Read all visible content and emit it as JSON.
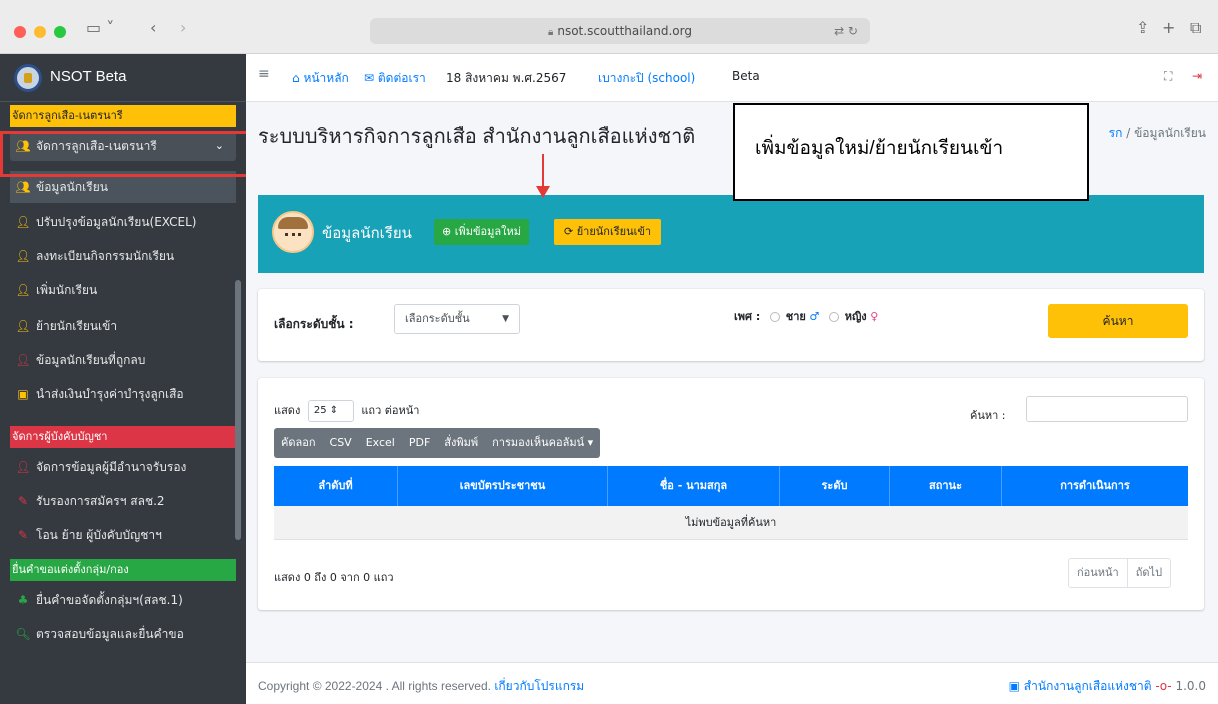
{
  "browser": {
    "url": "nsot.scoutthailand.org"
  },
  "sidebar": {
    "brand": "NSOT Beta",
    "section1": "จัดการลูกเสือ-เนตรนารี",
    "group_label": "จัดการลูกเสือ-เนตรนารี",
    "items": [
      {
        "label": "ข้อมูลนักเรียน",
        "icon": "users-icon"
      },
      {
        "label": "ปรับปรุงข้อมูลนักเรียน(EXCEL)",
        "icon": "user-edit-icon"
      },
      {
        "label": "ลงทะเบียนกิจกรรมนักเรียน",
        "icon": "user-check-icon"
      },
      {
        "label": "เพิ่มนักเรียน",
        "icon": "user-plus-icon"
      },
      {
        "label": "ย้ายนักเรียนเข้า",
        "icon": "user-plus-icon"
      },
      {
        "label": "ข้อมูลนักเรียนที่ถูกลบ",
        "icon": "user-minus-icon"
      },
      {
        "label": "นำส่งเงินบำรุงค่าบำรุงลูกเสือ",
        "icon": "money-icon"
      }
    ],
    "section2": "จัดการผู้บังคับบัญชา",
    "items2": [
      {
        "label": "จัดการข้อมูลผู้มีอำนาจรับรอง",
        "icon": "user-edit-icon"
      },
      {
        "label": "รับรองการสมัครฯ สลช.2",
        "icon": "edit-icon"
      },
      {
        "label": "โอน ย้าย ผู้บังคับบัญชาฯ",
        "icon": "edit-icon"
      }
    ],
    "section3": "ยื่นคำขอแต่งตั้งกลุ่ม/กอง",
    "items3": [
      {
        "label": "ยื่นคำขอจัดตั้งกลุ่มฯ(สลช.1)",
        "icon": "sitemap-icon"
      },
      {
        "label": "ตรวจสอบข้อมูลและยื่นคำขอ",
        "icon": "search-icon"
      }
    ]
  },
  "topbar": {
    "home": "หน้าหลัก",
    "contact": "ติดต่อเรา",
    "date": "18 สิงหาคม พ.ศ.2567",
    "school": "เบางกะปิ (school)",
    "beta": "Beta"
  },
  "page": {
    "title": "ระบบบริหารกิจการลูกเสือ สำนักงานลูกเสือแห่งชาติ",
    "crumb_link": "รก",
    "crumb_sep": " / ",
    "crumb_current": "ข้อมูลนักเรียน"
  },
  "banner": {
    "title": "ข้อมูลนักเรียน",
    "add_label": "เพิ่มข้อมูลใหม่",
    "move_label": "ย้ายนักเรียนเข้า"
  },
  "filter": {
    "level_label": "เลือกระดับชั้น :",
    "level_value": "เลือกระดับชั้น",
    "gender_label": "เพศ :",
    "male": "ชาย",
    "female": "หญิง",
    "search_button": "ค้นหา"
  },
  "table": {
    "show": "แสดง",
    "page_len": "25",
    "per_page": "แถว ต่อหน้า",
    "search_label": "ค้นหา :",
    "tools": [
      "คัดลอก",
      "CSV",
      "Excel",
      "PDF",
      "สั่งพิมพ์",
      "การมองเห็นคอลัมน์ ▾"
    ],
    "columns": [
      "ลำดับที่",
      "เลขบัตรประชาชน",
      "ชื่อ - นามสกุล",
      "ระดับ",
      "สถานะ",
      "การดำเนินการ"
    ],
    "empty": "ไม่พบข้อมูลที่ค้นหา",
    "info": "แสดง 0 ถึง 0 จาก 0 แถว",
    "prev": "ก่อนหน้า",
    "next": "ถัดไป"
  },
  "footer": {
    "copyright": "Copyright © 2022-2024 . All rights reserved.",
    "about": "เกี่ยวกับโปรแกรม",
    "org": "สำนักงานลูกเสือแห่งชาติ",
    "version": "1.0.0"
  },
  "annotation": {
    "text": "เพิ่มข้อมูลใหม่/ย้ายนักเรียนเข้า"
  },
  "colors": {
    "sidebar_bg": "#343a40",
    "warning": "#ffc107",
    "danger": "#dc3545",
    "success": "#28a745",
    "info": "#17a2b8",
    "primary": "#007bff"
  }
}
